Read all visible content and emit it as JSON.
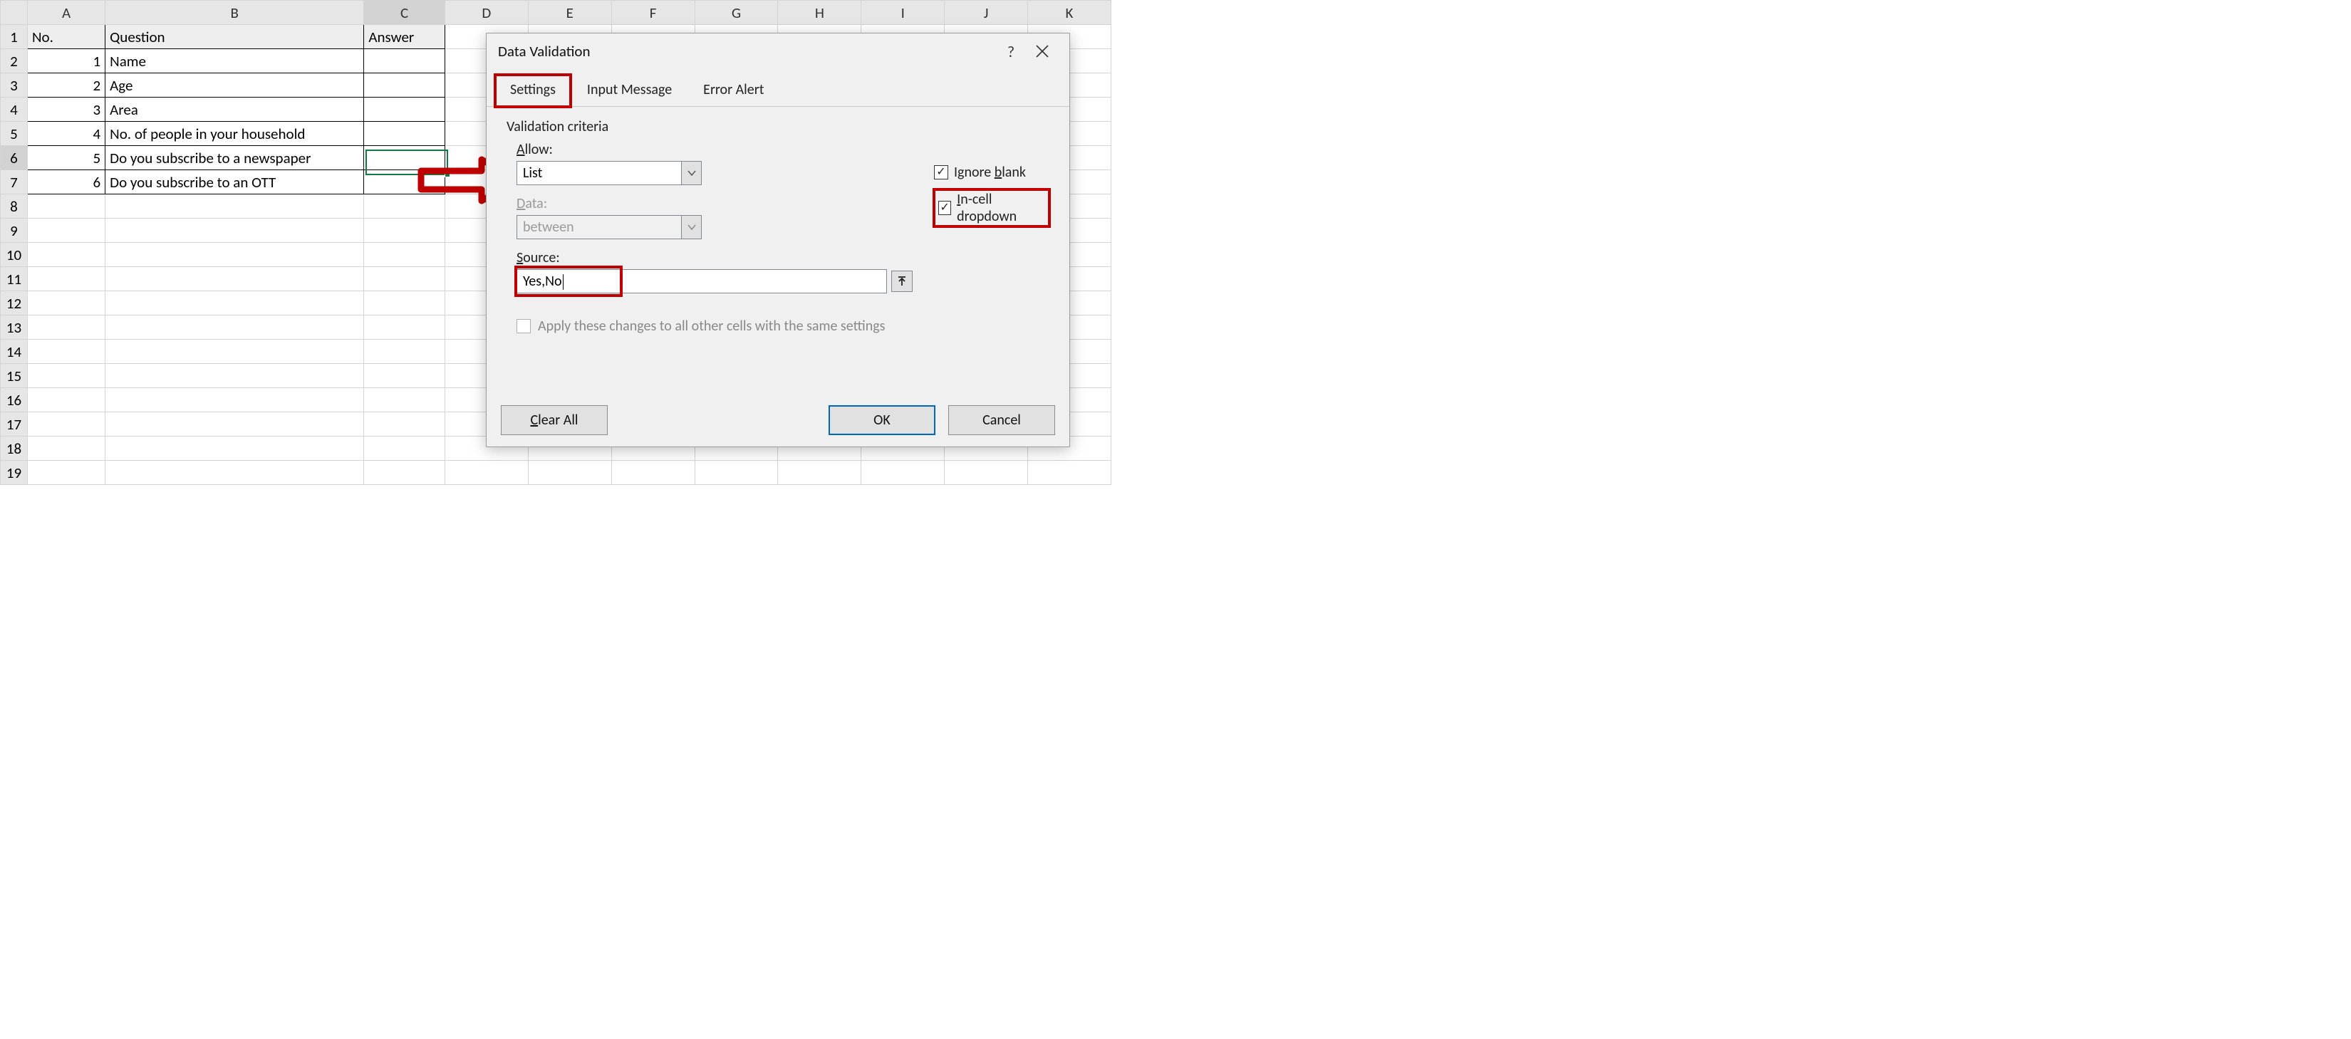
{
  "columns": [
    "A",
    "B",
    "C",
    "D",
    "E",
    "F",
    "G",
    "H",
    "I",
    "J",
    "K"
  ],
  "row_count": 19,
  "table": {
    "headers": {
      "a": "No.",
      "b": "Question",
      "c": "Answer"
    },
    "rows": [
      {
        "no": 1,
        "q": "Name",
        "a": ""
      },
      {
        "no": 2,
        "q": "Age",
        "a": ""
      },
      {
        "no": 3,
        "q": "Area",
        "a": ""
      },
      {
        "no": 4,
        "q": "No. of people in your household",
        "a": ""
      },
      {
        "no": 5,
        "q": "Do you subscribe to a newspaper",
        "a": ""
      },
      {
        "no": 6,
        "q": "Do you subscribe to an OTT",
        "a": ""
      }
    ]
  },
  "selection": {
    "cell": "C6"
  },
  "dialog": {
    "title": "Data Validation",
    "tabs": {
      "settings": "Settings",
      "input": "Input Message",
      "error": "Error Alert"
    },
    "criteria_label": "Validation criteria",
    "allow": {
      "label": "Allow:",
      "value": "List"
    },
    "ignore_blank": {
      "label": "Ignore blank",
      "checked": true
    },
    "incell": {
      "label": "In-cell dropdown",
      "checked": true
    },
    "data_field": {
      "label": "Data:",
      "value": "between"
    },
    "source": {
      "label": "Source:",
      "value": "Yes,No"
    },
    "apply_label": "Apply these changes to all other cells with the same settings",
    "buttons": {
      "clear": "Clear All",
      "ok": "OK",
      "cancel": "Cancel"
    }
  }
}
